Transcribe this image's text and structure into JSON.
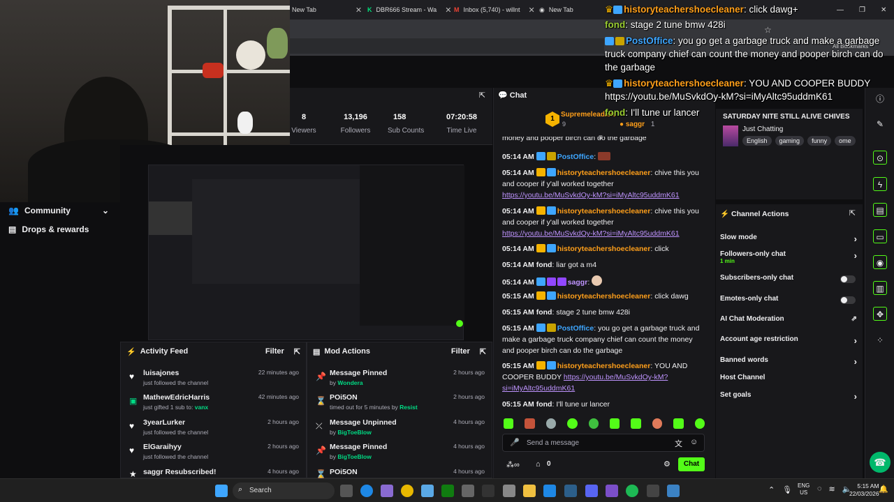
{
  "browser": {
    "tabs": [
      {
        "label": "New Tab"
      },
      {
        "label": "DBR666 Stream - Wa"
      },
      {
        "label": "Inbox (5,740) - willnt"
      },
      {
        "label": "New Tab"
      }
    ],
    "bookmarks_label": "All Bookmarks"
  },
  "nav": {
    "community": "Community",
    "drops": "Drops & rewards"
  },
  "stats": [
    {
      "value": "8",
      "label": "Viewers"
    },
    {
      "value": "13,196",
      "label": "Followers"
    },
    {
      "value": "158",
      "label": "Sub Counts"
    },
    {
      "value": "07:20:58",
      "label": "Time Live"
    }
  ],
  "activity_feed": {
    "title": "Activity Feed",
    "filter": "Filter",
    "items": [
      {
        "icon": "heart-icon",
        "name": "luisajones",
        "detail": "just followed the channel",
        "highlight": "",
        "time": "22 minutes ago"
      },
      {
        "icon": "gift-icon",
        "name": "MathewEdricHarris",
        "detail": "just gifted 1 sub to:",
        "highlight": "vanx",
        "time": "42 minutes ago"
      },
      {
        "icon": "heart-icon",
        "name": "3yearLurker",
        "detail": "just followed the channel",
        "highlight": "",
        "time": "2 hours ago"
      },
      {
        "icon": "heart-icon",
        "name": "ElGaraihyy",
        "detail": "just followed the channel",
        "highlight": "",
        "time": "2 hours ago"
      },
      {
        "icon": "star-icon",
        "name": "saggr Resubscribed!",
        "detail": "",
        "highlight": "",
        "time": "4 hours ago"
      }
    ]
  },
  "mod_actions": {
    "title": "Mod Actions",
    "filter": "Filter",
    "items": [
      {
        "icon": "pin-icon",
        "name": "Message Pinned",
        "detail": "by",
        "highlight": "Wondera",
        "time": "2 hours ago"
      },
      {
        "icon": "hourglass-icon",
        "name": "POi5ON",
        "detail": "timed out for 5 minutes by",
        "highlight": "Resist",
        "time": "2 hours ago"
      },
      {
        "icon": "unpin-icon",
        "name": "Message Unpinned",
        "detail": "by",
        "highlight": "BigToeBlow",
        "time": "4 hours ago"
      },
      {
        "icon": "pin-icon",
        "name": "Message Pinned",
        "detail": "by",
        "highlight": "BigToeBlow",
        "time": "4 hours ago"
      },
      {
        "icon": "hourglass-icon",
        "name": "POi5ON",
        "detail": "",
        "highlight": "",
        "time": "4 hours ago"
      }
    ]
  },
  "chat": {
    "title": "Chat",
    "leaderboard": [
      {
        "rank": "1",
        "name": "Supremeleadaxe",
        "count": "9"
      },
      {
        "rank": "",
        "name": "saggr",
        "count": "1"
      }
    ],
    "partial_line": "money and pooper birch can do the garbage",
    "messages": [
      {
        "time": "05:14 AM",
        "user": "PostOffice",
        "color": "#3ea6ff",
        "badges": [
          "b-blue",
          "b-kc"
        ],
        "text": "",
        "link": ""
      },
      {
        "time": "05:14 AM",
        "user": "historyteachershoecleaner",
        "color": "#ff9f1a",
        "badges": [
          "b-crown",
          "b-blue"
        ],
        "text": "chive this you and cooper if y'all worked together",
        "link": "https://youtu.be/MuSvkdOy-kM?si=iMyAltc95uddmK61"
      },
      {
        "time": "05:14 AM",
        "user": "historyteachershoecleaner",
        "color": "#ff9f1a",
        "badges": [
          "b-crown",
          "b-blue"
        ],
        "text": "chive this you and cooper if y'all worked together",
        "link": "https://youtu.be/MuSvkdOy-kM?si=iMyAltc95uddmK61"
      },
      {
        "time": "05:14 AM",
        "user": "historyteachershoecleaner",
        "color": "#ff9f1a",
        "badges": [
          "b-crown",
          "b-blue"
        ],
        "text": "click",
        "link": ""
      },
      {
        "time": "05:14 AM",
        "user": "fond",
        "color": "#efeff1",
        "badges": [],
        "text": "liar got a m4",
        "link": ""
      },
      {
        "time": "05:14 AM",
        "user": "saggr",
        "color": "#bf94ff",
        "badges": [
          "b-blue",
          "b-purple",
          "b-purple"
        ],
        "text": "",
        "link": ""
      },
      {
        "time": "05:15 AM",
        "user": "historyteachershoecleaner",
        "color": "#ff9f1a",
        "badges": [
          "b-crown",
          "b-blue"
        ],
        "text": "click dawg",
        "link": ""
      },
      {
        "time": "05:15 AM",
        "user": "fond",
        "color": "#efeff1",
        "badges": [],
        "text": "stage 2 tune bmw 428i",
        "link": ""
      },
      {
        "time": "05:15 AM",
        "user": "PostOffice",
        "color": "#3ea6ff",
        "badges": [
          "b-blue",
          "b-kc"
        ],
        "text": "you go get a garbage truck and make a garbage truck company chief can count the money and pooper birch can do the garbage",
        "link": ""
      },
      {
        "time": "05:15 AM",
        "user": "historyteachershoecleaner",
        "color": "#ff9f1a",
        "badges": [
          "b-crown",
          "b-blue"
        ],
        "text": "YOU AND COOPER BUDDY",
        "link": "https://youtu.be/MuSvkdOy-kM?si=iMyAltc95uddmK61"
      },
      {
        "time": "05:15 AM",
        "user": "fond",
        "color": "#efeff1",
        "badges": [],
        "text": "I'll tune ur lancer",
        "link": ""
      }
    ],
    "input_placeholder": "Send a message",
    "points": "0",
    "send_label": "Chat"
  },
  "stream_info": {
    "title": "SATURDAY NITE STILL ALIVE CHIVES",
    "category": "Just Chatting",
    "tags": [
      "English",
      "gaming",
      "funny",
      "ome"
    ]
  },
  "channel_actions": {
    "title": "Channel Actions",
    "items": [
      {
        "label": "Slow mode",
        "sub": "",
        "control": "chevron"
      },
      {
        "label": "Followers-only chat",
        "sub": "1 min",
        "control": "chevron"
      },
      {
        "label": "Subscribers-only chat",
        "sub": "",
        "control": "toggle"
      },
      {
        "label": "Emotes-only chat",
        "sub": "",
        "control": "toggle"
      },
      {
        "label": "AI Chat Moderation",
        "sub": "",
        "control": "external"
      },
      {
        "label": "Account age restriction",
        "sub": "",
        "control": "chevron"
      },
      {
        "label": "Banned words",
        "sub": "",
        "control": "chevron"
      },
      {
        "label": "Host Channel",
        "sub": "",
        "control": "none"
      },
      {
        "label": "Set goals",
        "sub": "",
        "control": "chevron"
      }
    ]
  },
  "overlay_chat": [
    {
      "user": "historyteachershoecleaner",
      "color": "#ff9f1a",
      "text": ": click dawg+"
    },
    {
      "user": "fond",
      "color": "#9acd32",
      "text": ": stage 2 tune bmw 428i"
    },
    {
      "user": "PostOffice",
      "color": "#3ea6ff",
      "text": ": you go get a garbage truck and make a garbage truck company chief can count the money and pooper birch can do the garbage"
    },
    {
      "user": "historyteachershoecleaner",
      "color": "#ff9f1a",
      "text": ": YOU AND COOPER BUDDY https://youtu.be/MuSvkdOy-kM?si=iMyAltc95uddmK61"
    },
    {
      "user": "fond",
      "color": "#9acd32",
      "text": ": I'll tune ur lancer"
    }
  ],
  "taskbar": {
    "search": "Search",
    "lang": "ENG",
    "region": "US",
    "time": "5:15 AM",
    "date": "22/03/2026"
  }
}
